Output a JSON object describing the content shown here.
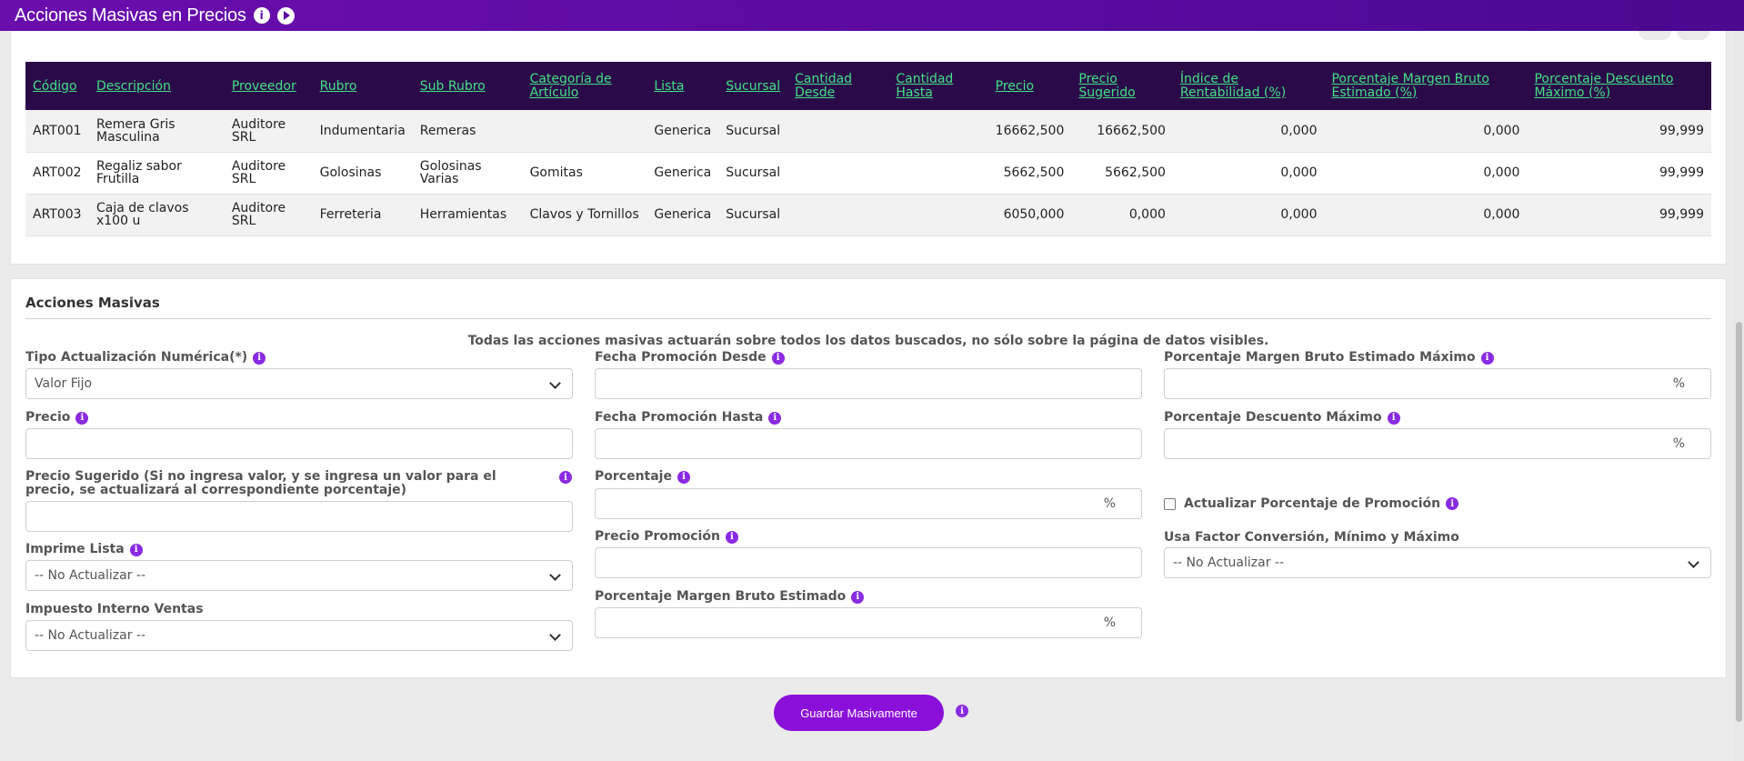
{
  "header": {
    "title": "Acciones Masivas en Precios"
  },
  "table": {
    "columns": [
      "Código",
      "Descripción",
      "Proveedor",
      "Rubro",
      "Sub Rubro",
      "Categoría de Artículo",
      "Lista",
      "Sucursal",
      "Cantidad Desde",
      "Cantidad Hasta",
      "Precio",
      "Precio Sugerido",
      "Índice de Rentabilidad (%)",
      "Porcentaje Margen Bruto Estimado (%)",
      "Porcentaje Descuento Máximo (%)"
    ],
    "rows": [
      [
        "ART001",
        "Remera Gris Masculina",
        "Auditore SRL",
        "Indumentaria",
        "Remeras",
        "",
        "Generica",
        "Sucursal",
        "",
        "",
        "16662,500",
        "16662,500",
        "0,000",
        "0,000",
        "99,999"
      ],
      [
        "ART002",
        "Regaliz sabor Frutilla",
        "Auditore SRL",
        "Golosinas",
        "Golosinas Varias",
        "Gomitas",
        "Generica",
        "Sucursal",
        "",
        "",
        "5662,500",
        "5662,500",
        "0,000",
        "0,000",
        "99,999"
      ],
      [
        "ART003",
        "Caja de clavos x100 u",
        "Auditore SRL",
        "Ferreteria",
        "Herramientas",
        "Clavos y Tornillos",
        "Generica",
        "Sucursal",
        "",
        "",
        "6050,000",
        "0,000",
        "0,000",
        "0,000",
        "99,999"
      ]
    ]
  },
  "actions": {
    "title": "Acciones Masivas",
    "notice": "Todas las acciones masivas actuarán sobre todos los datos buscados, no sólo sobre la página de datos visibles.",
    "tipo_label": "Tipo Actualización Numérica(*)",
    "tipo_value": "Valor Fijo",
    "precio_label": "Precio",
    "precio_sugerido_label": "Precio Sugerido (Si no ingresa valor, y se ingresa un valor para el precio, se actualizará al correspondiente porcentaje)",
    "imprime_label": "Imprime Lista",
    "imprime_value": "-- No Actualizar --",
    "impuesto_label": "Impuesto Interno Ventas",
    "impuesto_value": "-- No Actualizar --",
    "fecha_desde_label": "Fecha Promoción Desde",
    "fecha_hasta_label": "Fecha Promoción Hasta",
    "porcentaje_label": "Porcentaje",
    "precio_promo_label": "Precio Promoción",
    "margen_label": "Porcentaje Margen Bruto Estimado",
    "margen_max_label": "Porcentaje Margen Bruto Estimado Máximo",
    "descuento_max_label": "Porcentaje Descuento Máximo",
    "actualizar_promo_label": "Actualizar Porcentaje de Promoción",
    "usa_factor_label": "Usa Factor Conversión, Mínimo y Máximo",
    "usa_factor_value": "-- No Actualizar --",
    "percent_suffix": "%",
    "save_label": "Guardar Masivamente"
  }
}
